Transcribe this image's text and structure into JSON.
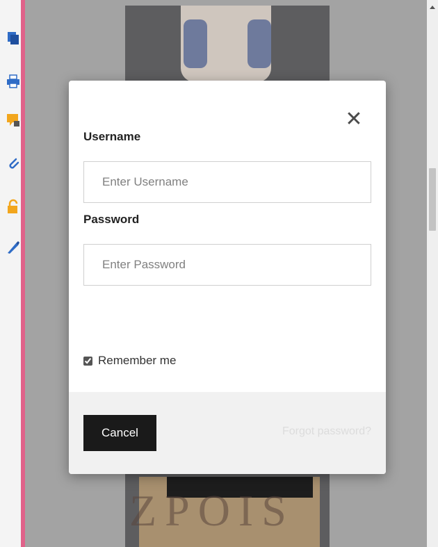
{
  "sidebar": {
    "tools": [
      {
        "icon": "pages-icon",
        "color": "#2f6cc6"
      },
      {
        "icon": "printer-icon",
        "color": "#2f6cc6"
      },
      {
        "icon": "comment-icon",
        "color": "#f2a61d"
      },
      {
        "icon": "attachment-icon",
        "color": "#2f6cc6"
      },
      {
        "icon": "lock-icon",
        "color": "#f2a61d"
      },
      {
        "icon": "signature-icon",
        "color": "#2f6cc6"
      }
    ]
  },
  "background": {
    "watermark_text": "ZPOIS"
  },
  "modal": {
    "close_symbol": "✕",
    "username_label": "Username",
    "username_placeholder": "Enter Username",
    "username_value": "",
    "password_label": "Password",
    "password_placeholder": "Enter Password",
    "password_value": "",
    "remember_label": "Remember me",
    "remember_checked": true,
    "cancel_label": "Cancel",
    "forgot_label": "Forgot password?"
  },
  "colors": {
    "accent_pink": "#e0628a",
    "button_dark": "#1a1a1a",
    "footer_bg": "#f1f1f1"
  }
}
